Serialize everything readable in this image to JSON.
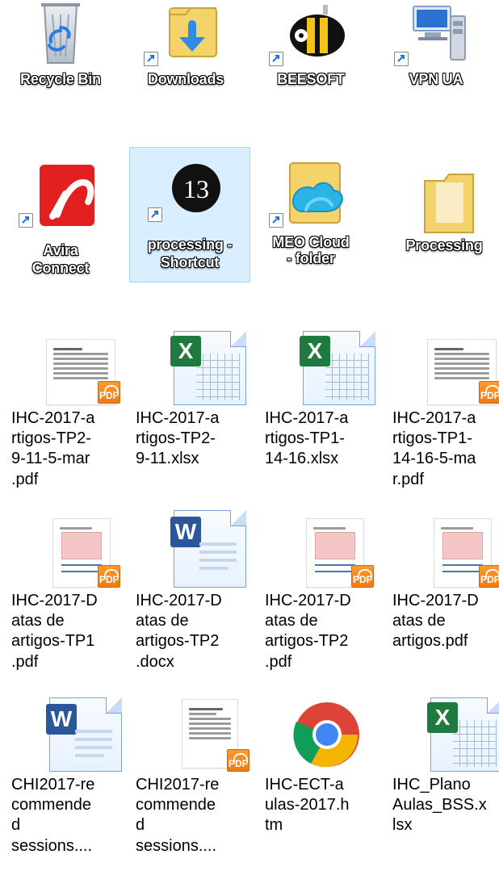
{
  "desktop": {
    "items": [
      {
        "label": "Recycle Bin",
        "icon": "recycle-bin-icon",
        "shortcut": false
      },
      {
        "label": "Downloads",
        "icon": "downloads-folder-icon",
        "shortcut": true
      },
      {
        "label": "BEESOFT",
        "icon": "beesoft-app-icon",
        "shortcut": true
      },
      {
        "label": "VPN UA",
        "icon": "vpn-computer-icon",
        "shortcut": true
      },
      {
        "label": "Avira\nConnect",
        "icon": "avira-app-icon",
        "shortcut": true
      },
      {
        "label": "processing -\nShortcut",
        "icon": "processing-app-icon",
        "shortcut": true,
        "selected": true
      },
      {
        "label": "MEO Cloud\n- folder",
        "icon": "meo-cloud-folder-icon",
        "shortcut": true
      },
      {
        "label": "Processing",
        "icon": "folder-icon",
        "shortcut": false
      },
      {
        "label": "IHC-2017-artigos-TP2-9-11-5-mar.pdf",
        "icon": "pdf-file-icon"
      },
      {
        "label": "IHC-2017-artigos-TP2-9-11.xlsx",
        "icon": "excel-file-icon"
      },
      {
        "label": "IHC-2017-artigos-TP1-14-16.xlsx",
        "icon": "excel-file-icon"
      },
      {
        "label": "IHC-2017-artigos-TP1-14-16-5-mar.pdf",
        "icon": "pdf-file-icon"
      },
      {
        "label": "IHC-2017-Datas de artigos-TP1.pdf",
        "icon": "pdf-file-icon"
      },
      {
        "label": "IHC-2017-Datas de artigos-TP2.docx",
        "icon": "word-file-icon"
      },
      {
        "label": "IHC-2017-Datas de artigos-TP2.pdf",
        "icon": "pdf-file-icon"
      },
      {
        "label": "IHC-2017-Datas de artigos.pdf",
        "icon": "pdf-file-icon"
      },
      {
        "label": "CHI2017-recommended sessions....",
        "icon": "word-file-icon"
      },
      {
        "label": "CHI2017-recommended sessions....",
        "icon": "pdf-file-icon"
      },
      {
        "label": "IHC-ECT-aulas-2017.htm",
        "icon": "chrome-html-file-icon"
      },
      {
        "label": "IHC_Plano Aulas_BSS.xlsx",
        "icon": "excel-file-icon"
      }
    ],
    "display_labels": {
      "recycle_bin": "Recycle Bin",
      "downloads": "Downloads",
      "beesoft": "BEESOFT",
      "vpn_ua": "VPN UA",
      "avira_1": "Avira",
      "avira_2": "Connect",
      "processing_shortcut_1": "processing -",
      "processing_shortcut_2": "Shortcut",
      "meo_1": "MEO Cloud",
      "meo_2": "- folder",
      "processing_folder": "Processing",
      "file_1_1": "IHC-2017-a",
      "file_1_2": "rtigos-TP2-",
      "file_1_3": "9-11-5-mar",
      "file_1_4": ".pdf",
      "file_2_1": "IHC-2017-a",
      "file_2_2": "rtigos-TP2-",
      "file_2_3": "9-11.xlsx",
      "file_3_1": "IHC-2017-a",
      "file_3_2": "rtigos-TP1-",
      "file_3_3": "14-16.xlsx",
      "file_4_1": "IHC-2017-a",
      "file_4_2": "rtigos-TP1-",
      "file_4_3": "14-16-5-ma",
      "file_4_4": "r.pdf",
      "file_5_1": "IHC-2017-D",
      "file_5_2": "atas de",
      "file_5_3": "artigos-TP1",
      "file_5_4": ".pdf",
      "file_6_1": "IHC-2017-D",
      "file_6_2": "atas de",
      "file_6_3": "artigos-TP2",
      "file_6_4": ".docx",
      "file_7_1": "IHC-2017-D",
      "file_7_2": "atas de",
      "file_7_3": "artigos-TP2",
      "file_7_4": ".pdf",
      "file_8_1": "IHC-2017-D",
      "file_8_2": "atas de",
      "file_8_3": "artigos.pdf",
      "file_9_1": "CHI2017-re",
      "file_9_2": "commende",
      "file_9_3": "d",
      "file_9_4": "sessions....",
      "file_10_1": "CHI2017-re",
      "file_10_2": "commende",
      "file_10_3": "d",
      "file_10_4": "sessions....",
      "file_11_1": "IHC-ECT-a",
      "file_11_2": "ulas-2017.h",
      "file_11_3": "tm",
      "file_12_1": "IHC_Plano",
      "file_12_2": "Aulas_BSS.x",
      "file_12_3": "lsx"
    },
    "colors": {
      "selected_bg": "#cce8ff",
      "selected_border": "#99d1ff",
      "pdf_orange": "#f28a1e",
      "excel_green": "#1f7a3f",
      "word_blue": "#2b579a",
      "avira_red": "#e02020",
      "folder_yellow": "#f3c54a",
      "download_blue": "#2f8be6"
    }
  }
}
